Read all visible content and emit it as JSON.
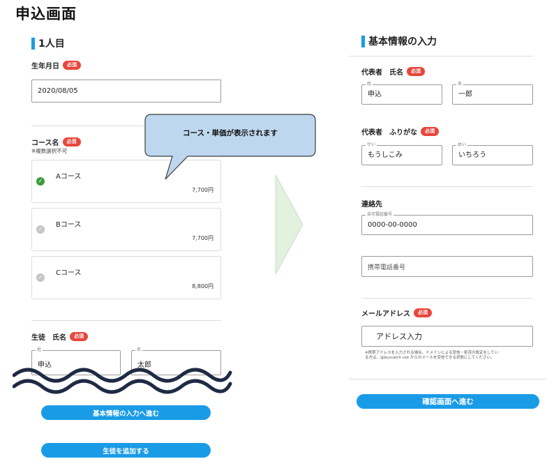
{
  "page_title": "申込画面",
  "left": {
    "section_title": "1人目",
    "birthdate": {
      "label": "生年月日",
      "required": "必須",
      "value": "2020/08/05"
    },
    "course": {
      "label": "コース名",
      "required": "必須",
      "note": "※複数選択不可",
      "options": [
        {
          "name": "Aコース",
          "price": "7,700円",
          "selected": true
        },
        {
          "name": "Bコース",
          "price": "7,700円",
          "selected": false
        },
        {
          "name": "Cコース",
          "price": "8,800円",
          "selected": false
        }
      ]
    },
    "callout_text": "コース・単価が表示されます",
    "student": {
      "label": "生徒　氏名",
      "required": "必須",
      "last_name_label": "姓",
      "last_name": "申込",
      "first_name_label": "名",
      "first_name": "太郎"
    },
    "next_button": "基本情報の入力へ進む",
    "add_student_button": "生徒を追加する"
  },
  "right": {
    "section_title": "基本情報の入力",
    "rep_name": {
      "label": "代表者　氏名",
      "required": "必須",
      "last_label": "姓",
      "last": "申込",
      "first_label": "名",
      "first": "一郎"
    },
    "rep_kana": {
      "label": "代表者　ふりがな",
      "required": "必須",
      "last_label": "せい",
      "last": "もうしこみ",
      "first_label": "めい",
      "first": "いちろう"
    },
    "contact": {
      "label": "連絡先",
      "home_label": "自宅電話番号",
      "home": "0000-00-0000",
      "mobile_placeholder": "携帯電話番号"
    },
    "email": {
      "label": "メールアドレス",
      "required": "必須",
      "value": "アドレス入力",
      "note_line1": "※携帯アドレスを入力される場合、ドメインによる受信・拒否の設定をしてい",
      "note_line2": "る方は、@buscatch.net からのメールを受信できる状態にしてください。"
    },
    "confirm_button": "確認画面へ進む"
  },
  "colors": {
    "accent": "#1a9be6",
    "required": "#e9463c",
    "check": "#3a9d3a",
    "arrow": "#e3f1df",
    "callout": "#bdd7ee"
  }
}
